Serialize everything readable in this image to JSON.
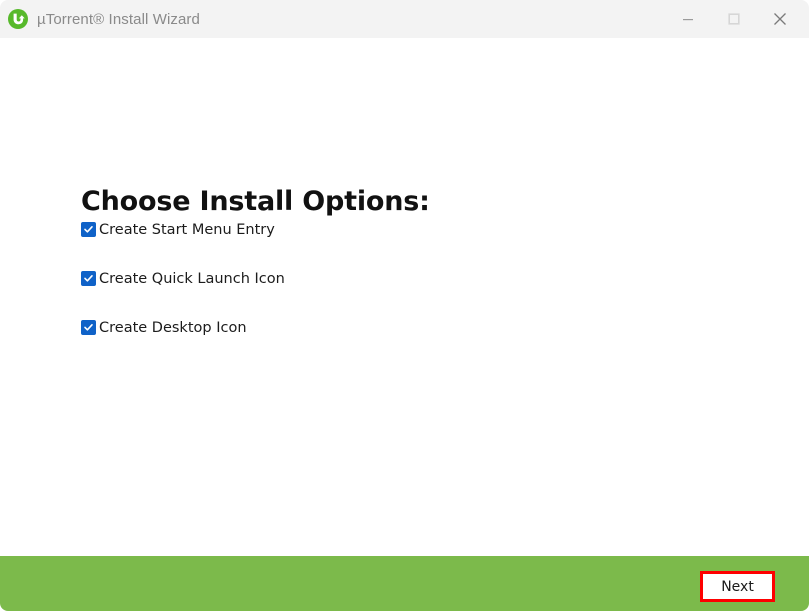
{
  "window": {
    "title": "µTorrent® Install Wizard",
    "app_icon": "utorrent-logo-icon",
    "controls": {
      "minimize": "minimize-icon",
      "maximize": "maximize-icon",
      "close": "close-icon"
    },
    "titlebar_bg": "#f3f3f3",
    "body_bg": "#ffffff"
  },
  "main": {
    "heading": "Choose Install Options:",
    "options": [
      {
        "label": "Create Start Menu Entry",
        "checked": true
      },
      {
        "label": "Create Quick Launch Icon",
        "checked": true
      },
      {
        "label": "Create Desktop Icon",
        "checked": true
      }
    ],
    "checkbox_color": "#0f62c8"
  },
  "footer": {
    "background": "#7cba4b",
    "next_label": "Next",
    "highlight_color": "#fe0000"
  }
}
